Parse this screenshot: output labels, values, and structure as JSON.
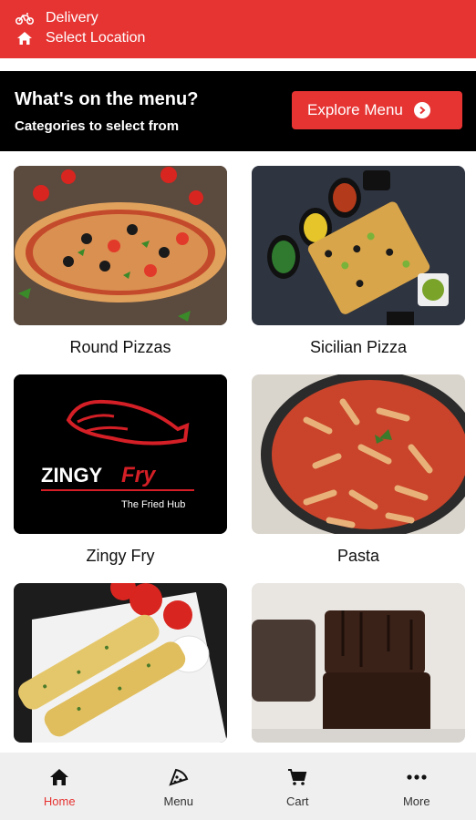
{
  "header": {
    "delivery_label": "Delivery",
    "location_label": "Select Location"
  },
  "banner": {
    "title": "What's on the menu?",
    "subtitle": "Categories to select from",
    "button_label": "Explore Menu"
  },
  "categories": [
    {
      "name": "Round Pizzas"
    },
    {
      "name": "Sicilian Pizza"
    },
    {
      "name": "Zingy Fry"
    },
    {
      "name": "Pasta"
    }
  ],
  "zingy_logo": {
    "word1": "ZINGY",
    "word2": "Fry",
    "tagline": "The Fried Hub"
  },
  "bottom_nav": [
    {
      "label": "Home",
      "icon": "home-icon",
      "active": true
    },
    {
      "label": "Menu",
      "icon": "pizza-slice-icon",
      "active": false
    },
    {
      "label": "Cart",
      "icon": "cart-icon",
      "active": false
    },
    {
      "label": "More",
      "icon": "more-icon",
      "active": false
    }
  ],
  "colors": {
    "brand": "#e63433",
    "banner": "#000000",
    "nav_bg": "#efefef"
  }
}
